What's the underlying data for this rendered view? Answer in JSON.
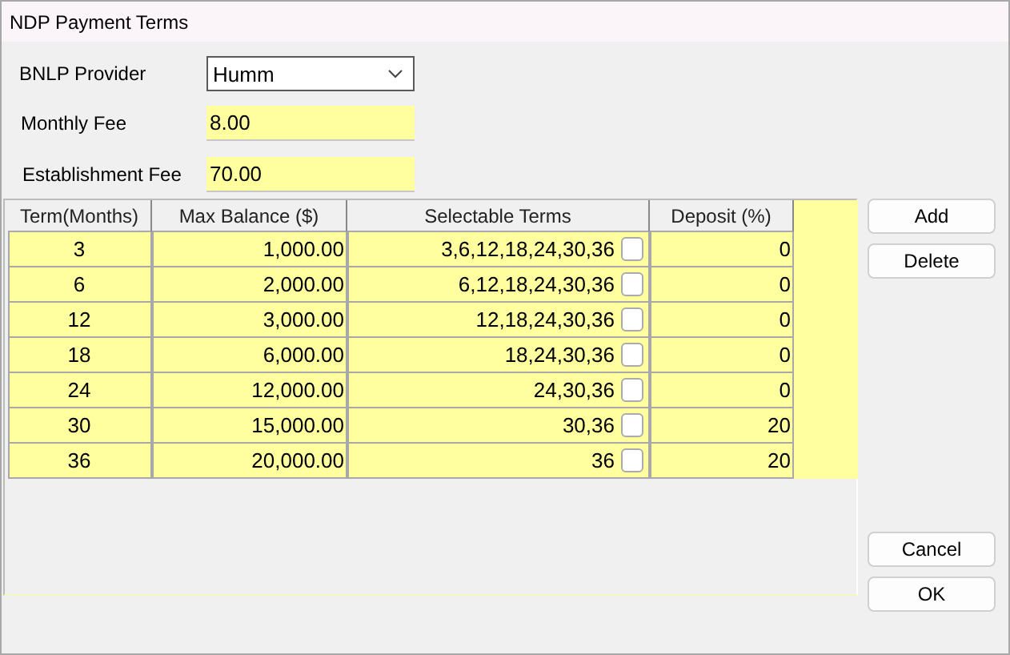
{
  "window": {
    "title": "NDP Payment Terms"
  },
  "fields": [
    {
      "kind": "dropdown",
      "label": "BNLP Provider",
      "value": "Humm"
    },
    {
      "kind": "text",
      "label": "Monthly Fee",
      "value": "8.00"
    },
    {
      "kind": "text",
      "label": "Establishment Fee",
      "value": "70.00"
    }
  ],
  "table": {
    "columns": [
      "Term(Months)",
      "Max Balance ($)",
      "Selectable Terms",
      "Deposit (%)"
    ],
    "rows": [
      {
        "term": "3",
        "max_balance": "1,000.00",
        "selectable_terms": "3,6,12,18,24,30,36",
        "checked": false,
        "deposit": "0"
      },
      {
        "term": "6",
        "max_balance": "2,000.00",
        "selectable_terms": "6,12,18,24,30,36",
        "checked": false,
        "deposit": "0"
      },
      {
        "term": "12",
        "max_balance": "3,000.00",
        "selectable_terms": "12,18,24,30,36",
        "checked": false,
        "deposit": "0"
      },
      {
        "term": "18",
        "max_balance": "6,000.00",
        "selectable_terms": "18,24,30,36",
        "checked": false,
        "deposit": "0"
      },
      {
        "term": "24",
        "max_balance": "12,000.00",
        "selectable_terms": "24,30,36",
        "checked": false,
        "deposit": "0"
      },
      {
        "term": "30",
        "max_balance": "15,000.00",
        "selectable_terms": "30,36",
        "checked": false,
        "deposit": "20"
      },
      {
        "term": "36",
        "max_balance": "20,000.00",
        "selectable_terms": "36",
        "checked": false,
        "deposit": "20"
      }
    ]
  },
  "side_buttons": [
    "Add",
    "Delete"
  ],
  "dialog_buttons": [
    "Cancel",
    "OK"
  ]
}
